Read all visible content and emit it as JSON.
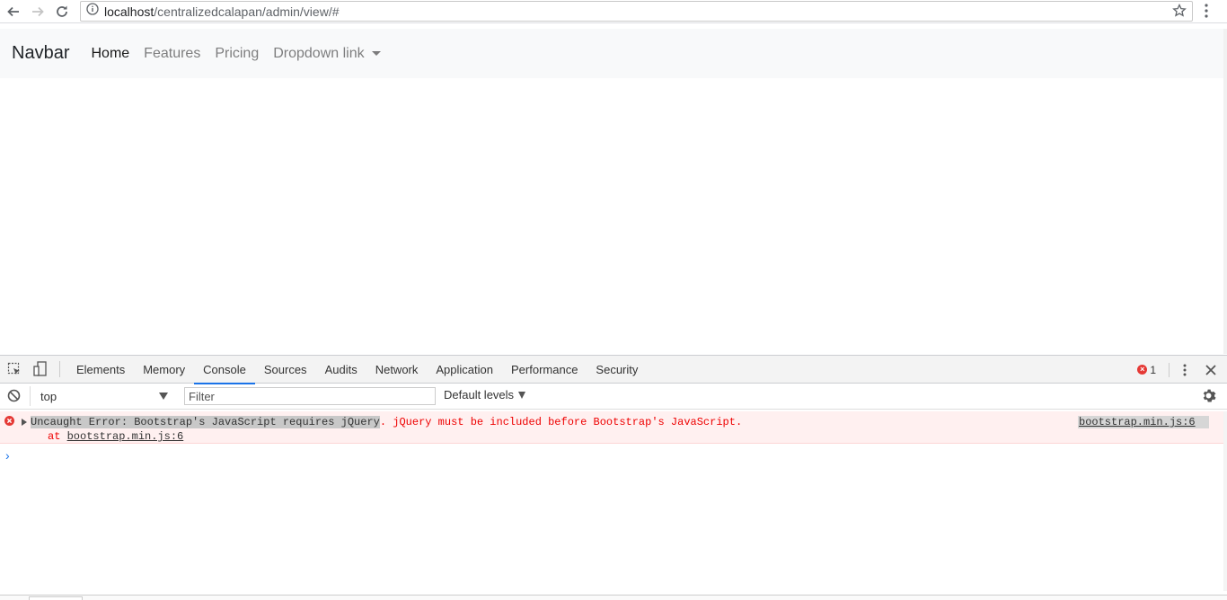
{
  "browser": {
    "url_host": "localhost",
    "url_path": "/centralizedcalapan/admin/view/#"
  },
  "navbar": {
    "brand": "Navbar",
    "links": [
      "Home",
      "Features",
      "Pricing",
      "Dropdown link"
    ]
  },
  "devtools": {
    "tabs": [
      "Elements",
      "Memory",
      "Console",
      "Sources",
      "Audits",
      "Network",
      "Application",
      "Performance",
      "Security"
    ],
    "active_tab": "Console",
    "error_count": "1",
    "context": "top",
    "filter_placeholder": "Filter",
    "levels_label": "Default levels",
    "error": {
      "highlighted": "Uncaught Error: Bootstrap's JavaScript requires jQuery",
      "rest": ". jQuery must be included before Bootstrap's JavaScript.",
      "at_prefix": "at ",
      "at_link": "bootstrap.min.js:6",
      "source": "bootstrap.min.js:6"
    },
    "prompt": "›"
  },
  "colors": {
    "navbar_bg": "#f8f9fa",
    "error_text": "#ee0000",
    "error_bg": "#fff0f0",
    "active_tab_underline": "#1a73e8"
  }
}
